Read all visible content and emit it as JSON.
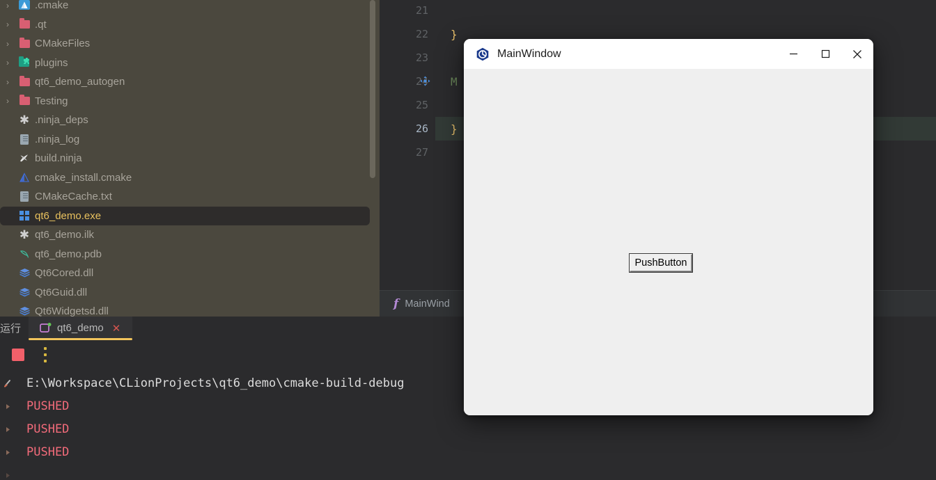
{
  "editor": {
    "lines": [
      {
        "num": "21",
        "text": "",
        "highlight": false,
        "gutter_icon": ""
      },
      {
        "num": "22",
        "text": "}",
        "highlight": false,
        "gutter_icon": ""
      },
      {
        "num": "23",
        "text": "",
        "highlight": false,
        "gutter_icon": ""
      },
      {
        "num": "24",
        "text": "M",
        "highlight": false,
        "gutter_icon": "move-handle-icon"
      },
      {
        "num": "25",
        "text": "",
        "highlight": false,
        "gutter_icon": ""
      },
      {
        "num": "26",
        "text": "}",
        "highlight": true,
        "gutter_icon": ""
      },
      {
        "num": "27",
        "text": "",
        "highlight": false,
        "gutter_icon": ""
      }
    ],
    "breadcrumb": {
      "icon": "function-icon",
      "icon_glyph": "f",
      "text": "MainWind"
    }
  },
  "sidebar": {
    "items": [
      {
        "label": ".cmake",
        "arrow": "›",
        "icon": "cmake-icon",
        "indent": 36,
        "selected": false
      },
      {
        "label": ".qt",
        "arrow": "›",
        "icon": "folder-pink-icon",
        "indent": 36,
        "selected": false
      },
      {
        "label": "CMakeFiles",
        "arrow": "›",
        "icon": "folder-pink-icon",
        "indent": 36,
        "selected": false
      },
      {
        "label": "plugins",
        "arrow": "›",
        "icon": "plugin-folder-icon",
        "indent": 36,
        "selected": false
      },
      {
        "label": "qt6_demo_autogen",
        "arrow": "›",
        "icon": "folder-pink-icon",
        "indent": 36,
        "selected": false
      },
      {
        "label": "Testing",
        "arrow": "›",
        "icon": "folder-pink-icon",
        "indent": 36,
        "selected": false
      },
      {
        "label": ".ninja_deps",
        "arrow": "",
        "icon": "asterisk-file-icon",
        "indent": 36,
        "selected": false
      },
      {
        "label": ".ninja_log",
        "arrow": "",
        "icon": "text-file-icon",
        "indent": 36,
        "selected": false
      },
      {
        "label": "build.ninja",
        "arrow": "",
        "icon": "ninja-file-icon",
        "indent": 36,
        "selected": false
      },
      {
        "label": "cmake_install.cmake",
        "arrow": "",
        "icon": "cmake-file-icon",
        "indent": 36,
        "selected": false
      },
      {
        "label": "CMakeCache.txt",
        "arrow": "",
        "icon": "text-file-icon",
        "indent": 36,
        "selected": false
      },
      {
        "label": "qt6_demo.exe",
        "arrow": "",
        "icon": "windows-exe-icon",
        "indent": 36,
        "selected": true
      },
      {
        "label": "qt6_demo.ilk",
        "arrow": "",
        "icon": "asterisk-file-icon",
        "indent": 36,
        "selected": false
      },
      {
        "label": "qt6_demo.pdb",
        "arrow": "",
        "icon": "pdb-file-icon",
        "indent": 36,
        "selected": false
      },
      {
        "label": "Qt6Cored.dll",
        "arrow": "",
        "icon": "dll-file-icon",
        "indent": 36,
        "selected": false
      },
      {
        "label": "Qt6Guid.dll",
        "arrow": "",
        "icon": "dll-file-icon",
        "indent": 36,
        "selected": false
      },
      {
        "label": "Qt6Widgetsd.dll",
        "arrow": "",
        "icon": "dll-file-icon",
        "indent": 36,
        "selected": false
      }
    ]
  },
  "run_panel": {
    "tool_window_label": "运行",
    "tab": {
      "icon": "run-config-icon",
      "label": "qt6_demo",
      "close_icon": "close-icon",
      "running_indicator": true
    },
    "toolbar": {
      "stop_label": "stop-button",
      "more_label": "more-options-button"
    },
    "console": [
      {
        "text": "E:\\Workspace\\CLionProjects\\qt6_demo\\cmake-build-debug",
        "kind": "path",
        "marker": "run-marker"
      },
      {
        "text": "PUSHED",
        "kind": "pushed",
        "marker": "output-marker"
      },
      {
        "text": "PUSHED",
        "kind": "pushed",
        "marker": "output-marker"
      },
      {
        "text": "PUSHED",
        "kind": "pushed",
        "marker": "output-marker"
      }
    ]
  },
  "main_window": {
    "app_icon": "qt-app-icon",
    "title": "MainWindow",
    "controls": {
      "minimize": "—",
      "maximize": "□",
      "close": "✕"
    },
    "push_button_label": "PushButton"
  },
  "colors": {
    "ide_background": "#2b2b2d",
    "sidebar_background": "#4b483e",
    "selected_row_background": "#2e2c2b",
    "selected_row_text": "#e8c15e",
    "tab_underline": "#f2c55c",
    "console_error_text": "#f26b7a",
    "stop_button": "#f2606a",
    "dialog_body": "#efefef",
    "dialog_title_bar": "#ffffff"
  }
}
